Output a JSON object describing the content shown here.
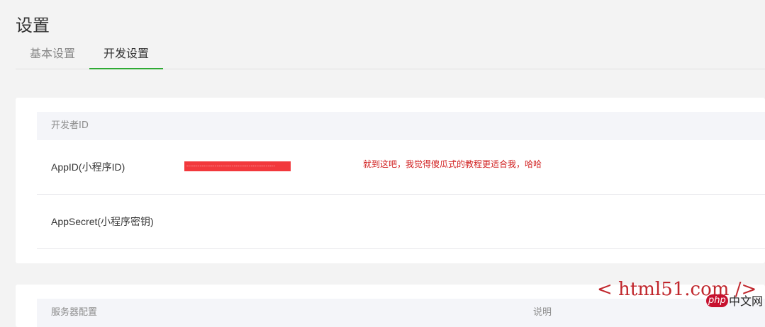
{
  "page": {
    "title": "设置"
  },
  "tabs": [
    {
      "label": "基本设置",
      "active": false
    },
    {
      "label": "开发设置",
      "active": true
    }
  ],
  "developer_id": {
    "section_label": "开发者ID",
    "rows": [
      {
        "label": "AppID(小程序ID)",
        "value_redacted": true
      },
      {
        "label": "AppSecret(小程序密钥)"
      }
    ],
    "annotation": "就到这吧，我觉得傻瓜式的教程更适合我，哈哈"
  },
  "server_config": {
    "section_label": "服务器配置",
    "desc_label": "说明"
  },
  "watermarks": {
    "html51": "< html51.com />",
    "php_logo": "php",
    "php_text": "中文网"
  },
  "colors": {
    "active_tab_underline": "#2faa34",
    "redaction": "#f2383c",
    "annotation": "#d12020"
  }
}
